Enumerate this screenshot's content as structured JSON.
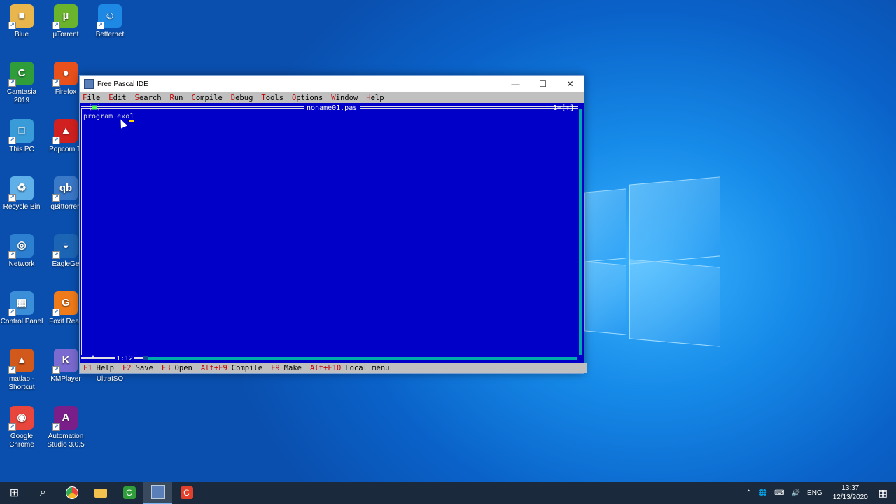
{
  "desktop_icons": [
    {
      "label": "Blue",
      "color": "#e8b64c",
      "glyph": "■"
    },
    {
      "label": "µTorrent",
      "color": "#6ab42d",
      "glyph": "µ"
    },
    {
      "label": "Betternet",
      "color": "#1e88e5",
      "glyph": "☺"
    },
    {
      "label": "Camtasia 2019",
      "color": "#2f9e3a",
      "glyph": "C"
    },
    {
      "label": "Firefox",
      "color": "#e8501c",
      "glyph": "●"
    },
    {
      "label": "This PC",
      "color": "#3a9bd9",
      "glyph": "□"
    },
    {
      "label": "Popcorn Ti",
      "color": "#d02020",
      "glyph": "▲"
    },
    {
      "label": "Recycle Bin",
      "color": "#5fb0e8",
      "glyph": "♻"
    },
    {
      "label": "qBittorren",
      "color": "#3a78c8",
      "glyph": "qb"
    },
    {
      "label": "Network",
      "color": "#2d7fd0",
      "glyph": "◎"
    },
    {
      "label": "EagleGe",
      "color": "#1c64b4",
      "glyph": "◒"
    },
    {
      "label": "Control Panel",
      "color": "#3b8ed8",
      "glyph": "▦"
    },
    {
      "label": "Foxit Reac",
      "color": "#f07b1a",
      "glyph": "G"
    },
    {
      "label": "matlab - Shortcut",
      "color": "#d2591c",
      "glyph": "▲"
    },
    {
      "label": "KMPlayer",
      "color": "#7a6bd0",
      "glyph": "K"
    },
    {
      "label": "UltraISO",
      "color": "#8a8a8a",
      "glyph": "U"
    },
    {
      "label": "Google Chrome",
      "color": "#e8453c",
      "glyph": "◉"
    },
    {
      "label": "Automation Studio 3.0.5",
      "color": "#7a1f8a",
      "glyph": "A"
    }
  ],
  "window": {
    "title": "Free Pascal IDE",
    "minimize": "—",
    "maximize": "☐",
    "close": "✕"
  },
  "menu": [
    {
      "hk": "F",
      "rest": "ile"
    },
    {
      "hk": "E",
      "rest": "dit"
    },
    {
      "hk": "S",
      "rest": "earch"
    },
    {
      "hk": "R",
      "rest": "un"
    },
    {
      "hk": "C",
      "rest": "ompile"
    },
    {
      "hk": "D",
      "rest": "ebug"
    },
    {
      "hk": "T",
      "rest": "ools"
    },
    {
      "hk": "O",
      "rest": "ptions"
    },
    {
      "hk": "W",
      "rest": "indow"
    },
    {
      "hk": "H",
      "rest": "elp"
    }
  ],
  "editor": {
    "filename": "noname01.pas",
    "close_box": "[■]",
    "window_number": "1=[↑]",
    "code_text": "program exo",
    "cursor_char": "1",
    "cursor_position": "1:12",
    "modified_mark": "*"
  },
  "status": [
    {
      "key": "F1",
      "label": "Help"
    },
    {
      "key": "F2",
      "label": "Save"
    },
    {
      "key": "F3",
      "label": "Open"
    },
    {
      "key": "Alt+F9",
      "label": "Compile"
    },
    {
      "key": "F9",
      "label": "Make"
    },
    {
      "key": "Alt+F10",
      "label": "Local menu"
    }
  ],
  "taskbar": {
    "start": "⊞",
    "search": "⌕",
    "apps": [
      "chrome-icon",
      "file-explorer-icon",
      "camtasia-icon",
      "free-pascal-icon",
      "recorder-icon"
    ],
    "tray_lang": "ENG",
    "time": "13:37",
    "date": "12/13/2020"
  }
}
